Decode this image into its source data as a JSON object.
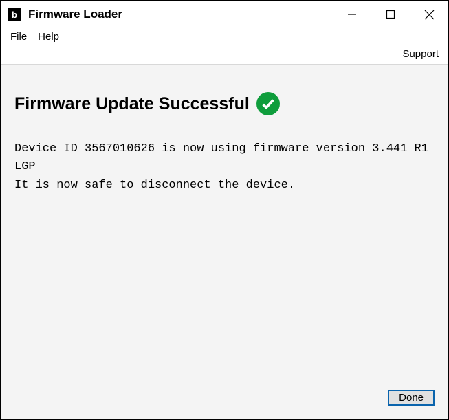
{
  "titlebar": {
    "icon_letter": "b",
    "title": "Firmware Loader"
  },
  "menubar": {
    "file": "File",
    "help": "Help"
  },
  "toolbar": {
    "support": "Support"
  },
  "content": {
    "heading": "Firmware Update Successful",
    "message_line1": "Device ID 3567010626 is now using firmware version 3.441 R1 LGP",
    "message_line2": "It is now safe to disconnect the device."
  },
  "footer": {
    "done": "Done"
  }
}
